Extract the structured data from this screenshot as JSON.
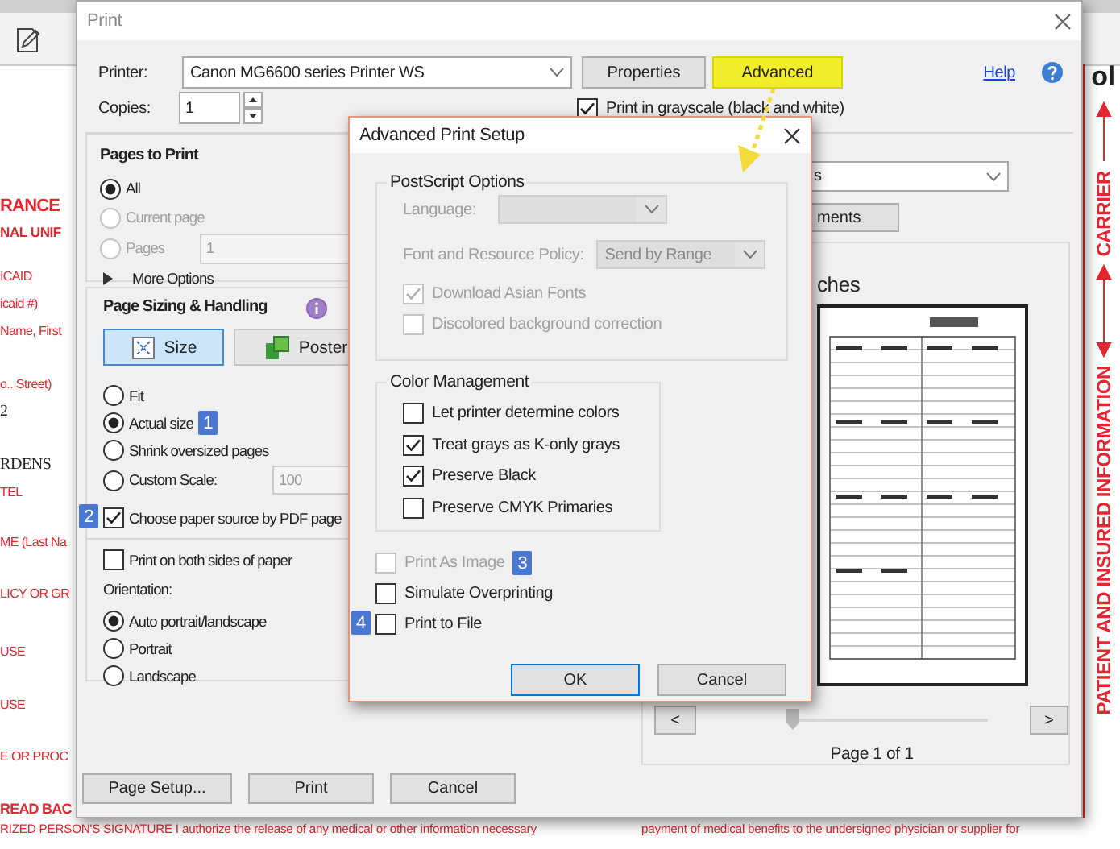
{
  "background": {
    "toolbar_label": "ol",
    "form_fragments": [
      {
        "text": "RANCE",
        "kind": "title"
      },
      {
        "text": "NAL UNIF",
        "kind": "subtitle"
      },
      {
        "text": "ICAID",
        "kind": "label"
      },
      {
        "text": "icaid #)",
        "kind": "label"
      },
      {
        "text": "Name, First",
        "kind": "label"
      },
      {
        "text": "o.. Street)",
        "kind": "label"
      },
      {
        "text": "2",
        "kind": "value"
      },
      {
        "text": "RDENS",
        "kind": "value"
      },
      {
        "text": "TEL",
        "kind": "label"
      },
      {
        "text": "ME (Last Na",
        "kind": "label"
      },
      {
        "text": "LICY OR GR",
        "kind": "label"
      },
      {
        "text": "USE",
        "kind": "label"
      },
      {
        "text": "USE",
        "kind": "label"
      },
      {
        "text": "E OR PROC",
        "kind": "label"
      },
      {
        "text": "READ BAC",
        "kind": "title"
      }
    ],
    "signature_left": "RIZED PERSON'S SIGNATURE I authorize the release of any medical or other information necessary",
    "signature_right": "payment of medical benefits to the undersigned physician or supplier for",
    "side_labels": [
      "CARRIER",
      "PATIENT AND INSURED INFORMATION"
    ]
  },
  "print_dialog": {
    "title": "Print",
    "printer": {
      "label": "Printer:",
      "value": "Canon MG6600 series Printer WS"
    },
    "top_buttons": [
      {
        "label": "Properties",
        "highlighted": false
      },
      {
        "label": "Advanced",
        "highlighted": true
      }
    ],
    "help_link": "Help",
    "copies": {
      "label": "Copies:",
      "value": "1"
    },
    "grayscale": {
      "label": "Print in grayscale (black and white)",
      "checked": true
    },
    "pages_to_print": {
      "title": "Pages to Print",
      "options": [
        {
          "label": "All",
          "selected": true,
          "disabled": false
        },
        {
          "label": "Current page",
          "selected": false,
          "disabled": true
        },
        {
          "label": "Pages",
          "selected": false,
          "disabled": true,
          "value": "1"
        }
      ],
      "more_options": "More Options"
    },
    "page_sizing": {
      "title": "Page Sizing & Handling",
      "modes": [
        {
          "label": "Size",
          "selected": true
        },
        {
          "label": "Poster",
          "selected": false
        }
      ],
      "scaling": [
        {
          "label": "Fit",
          "selected": false
        },
        {
          "label": "Actual size",
          "selected": true,
          "badge": "1"
        },
        {
          "label": "Shrink oversized pages",
          "selected": false
        },
        {
          "label": "Custom Scale:",
          "selected": false,
          "value": "100"
        }
      ],
      "paper_source": {
        "label": "Choose paper source by PDF page",
        "checked": true,
        "badge": "2"
      },
      "both_sides": {
        "label": "Print on both sides of paper",
        "checked": false
      },
      "orientation_label": "Orientation:",
      "orientation": [
        {
          "label": "Auto portrait/landscape",
          "selected": true
        },
        {
          "label": "Portrait",
          "selected": false
        },
        {
          "label": "Landscape",
          "selected": false
        }
      ]
    },
    "page_setup_button": "Page Setup...",
    "comments_select_fragment": "s",
    "summarize_button_fragment": "ments",
    "paper_size_fragment": "ches",
    "preview": {
      "slider": {
        "level": 0
      },
      "prev": "<",
      "next": ">",
      "page_label": "Page 1 of 1"
    },
    "bottom_buttons": [
      "Print",
      "Cancel"
    ]
  },
  "advanced_dialog": {
    "title": "Advanced Print Setup",
    "postscript": {
      "title": "PostScript Options",
      "language_label": "Language:",
      "font_policy_label": "Font and Resource Policy:",
      "font_policy_value": "Send by Range",
      "options": [
        {
          "label": "Download Asian Fonts",
          "checked": true,
          "disabled": true
        },
        {
          "label": "Discolored background correction",
          "checked": false,
          "disabled": true
        }
      ]
    },
    "color_management": {
      "title": "Color Management",
      "options": [
        {
          "label": "Let printer determine colors",
          "checked": false
        },
        {
          "label": "Treat grays as K-only grays",
          "checked": true
        },
        {
          "label": "Preserve Black",
          "checked": true
        },
        {
          "label": "Preserve CMYK Primaries",
          "checked": false
        }
      ]
    },
    "options": [
      {
        "label": "Print As Image",
        "checked": false,
        "disabled": true,
        "badge": "3"
      },
      {
        "label": "Simulate Overprinting",
        "checked": false,
        "disabled": false
      },
      {
        "label": "Print to File",
        "checked": false,
        "disabled": false,
        "badge": "4"
      }
    ],
    "buttons": [
      "OK",
      "Cancel"
    ]
  }
}
